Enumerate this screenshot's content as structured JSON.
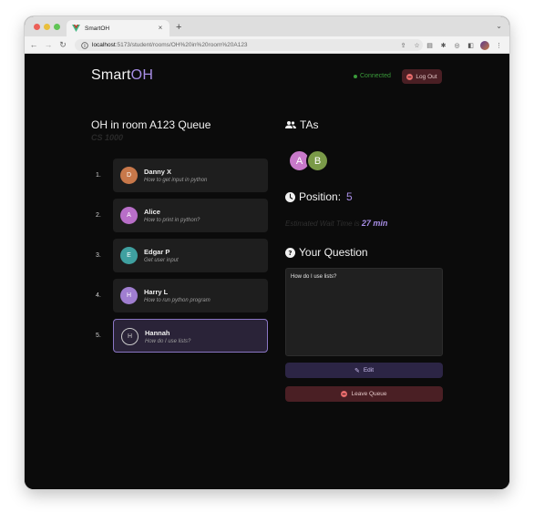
{
  "browser": {
    "tab_title": "SmartOH",
    "url_host": "localhost",
    "url_path": ":5173/student/rooms/OH%20in%20room%20A123"
  },
  "header": {
    "brand_main": "Smart",
    "brand_accent": "OH",
    "status": "Connected",
    "logout_label": "Log Out"
  },
  "room": {
    "title": "OH in room A123 Queue",
    "course": "CS 1000"
  },
  "queue": [
    {
      "num": "1.",
      "initial": "D",
      "name": "Danny X",
      "topic": "How to get input in python",
      "color": "#c8784a"
    },
    {
      "num": "2.",
      "initial": "A",
      "name": "Alice",
      "topic": "How to print in python?",
      "color": "#b86ec8"
    },
    {
      "num": "3.",
      "initial": "E",
      "name": "Edgar P",
      "topic": "Get user input",
      "color": "#3fa0a0"
    },
    {
      "num": "4.",
      "initial": "H",
      "name": "Harry L",
      "topic": "How to run python program",
      "color": "#a07ed0"
    },
    {
      "num": "5.",
      "initial": "H",
      "name": "Hannah",
      "topic": "How do I use lists?",
      "color": ""
    }
  ],
  "tas": {
    "heading": "TAs",
    "avatars": [
      {
        "initial": "A",
        "color": "#c879c9"
      },
      {
        "initial": "B",
        "color": "#7a9a48"
      }
    ]
  },
  "position": {
    "label": "Position:",
    "value": "5"
  },
  "wait": {
    "label": "Estimated Wait Time is",
    "value": "27 min"
  },
  "question": {
    "heading": "Your Question",
    "text": "How do I use lists?",
    "edit_label": "Edit",
    "leave_label": "Leave Queue"
  }
}
